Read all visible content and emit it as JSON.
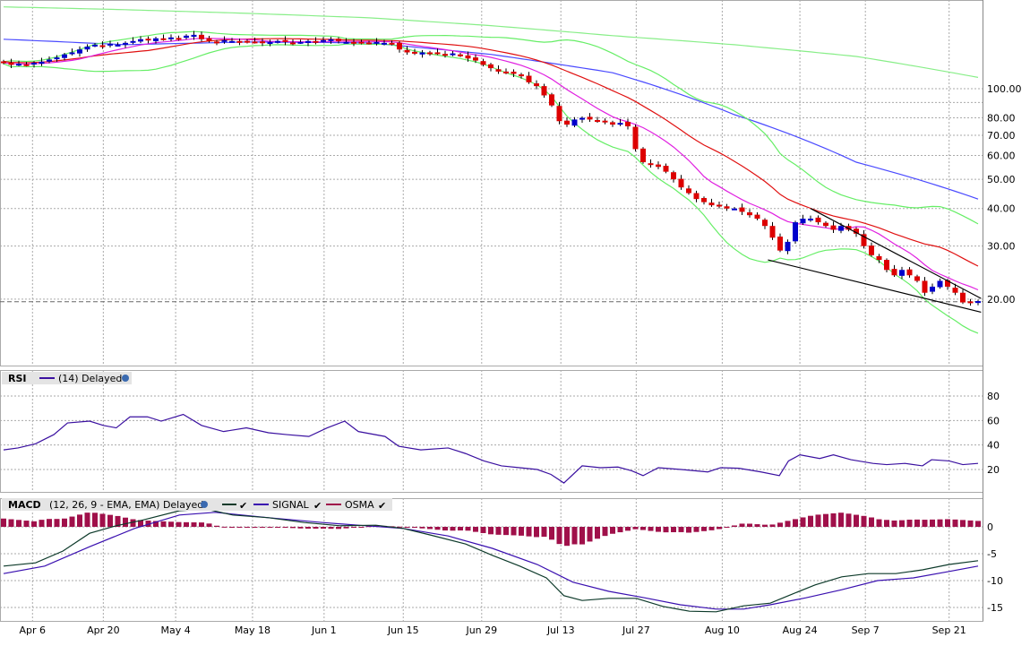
{
  "chart_data": {
    "type": "candlestick",
    "price_scale": "log",
    "price_ticks": [
      "100.00",
      "80.00",
      "70.00",
      "60.00",
      "50.00",
      "40.00",
      "30.00",
      "20.00"
    ],
    "price_tick_values": [
      100,
      80,
      70,
      60,
      50,
      40,
      30,
      20
    ],
    "last_price_line": 19.6,
    "closes": [
      122,
      120,
      121,
      120,
      122,
      123,
      125,
      127,
      130,
      132,
      135,
      138,
      140,
      139,
      141,
      140,
      142,
      144,
      146,
      145,
      147,
      146,
      148,
      147,
      150,
      151,
      146,
      144,
      143,
      145,
      144,
      143,
      144,
      143,
      142,
      143,
      144,
      143,
      142,
      143,
      144,
      143,
      145,
      146,
      144,
      143,
      142,
      143,
      142,
      143,
      142,
      141,
      135,
      132,
      131,
      132,
      131,
      131,
      130,
      131,
      129,
      126,
      124,
      120,
      117,
      114,
      113,
      112,
      110,
      105,
      102,
      95,
      88,
      78,
      76,
      79,
      80,
      79,
      78,
      78,
      76,
      77,
      75,
      63,
      57,
      56,
      55,
      53,
      50,
      47,
      45,
      43,
      42,
      41,
      41,
      40,
      40,
      39,
      38,
      37,
      35,
      32,
      29,
      31,
      36,
      37,
      37,
      36,
      35,
      34,
      35,
      34,
      33,
      30,
      28,
      27,
      25,
      24,
      25,
      24,
      23,
      21,
      22,
      23,
      22,
      21,
      19.5,
      19.5,
      19.7
    ],
    "ma50_samples": {
      "index": [
        0,
        16,
        32,
        48,
        64,
        80,
        96,
        112,
        128
      ],
      "values": [
        146,
        140,
        143,
        142,
        130,
        113,
        82,
        57,
        43
      ]
    },
    "ma200_samples": {
      "index": [
        0,
        16,
        32,
        48,
        64,
        80,
        96,
        112,
        128
      ],
      "values": [
        187,
        183,
        178,
        172,
        162,
        150,
        140,
        128,
        109
      ]
    },
    "trendlines": [
      {
        "from": [
          106,
          40
        ],
        "to": [
          128.4,
          20.1
        ]
      },
      {
        "from": [
          100.4,
          27
        ],
        "to": [
          128.4,
          18.1
        ]
      }
    ],
    "x_ticks": [
      {
        "label": "Apr 6",
        "index": 3.8
      },
      {
        "label": "Apr 20",
        "index": 13.1
      },
      {
        "label": "May 4",
        "index": 22.6
      },
      {
        "label": "May 18",
        "index": 32.7
      },
      {
        "label": "Jun 1",
        "index": 42.1
      },
      {
        "label": "Jun 15",
        "index": 52.5
      },
      {
        "label": "Jun 29",
        "index": 62.8
      },
      {
        "label": "Jul 13",
        "index": 73.2
      },
      {
        "label": "Jul 27",
        "index": 83.1
      },
      {
        "label": "Aug 10",
        "index": 94.4
      },
      {
        "label": "Aug 24",
        "index": 104.6
      },
      {
        "label": "Sep 7",
        "index": 113.2
      },
      {
        "label": "Sep 21",
        "index": 124.2
      }
    ],
    "rsi": {
      "label": "RSI",
      "params": "(14) Delayed",
      "ticks": [
        "80",
        "60",
        "40",
        "20"
      ],
      "tick_values": [
        80,
        60,
        40,
        20
      ],
      "points": [
        [
          0,
          36
        ],
        [
          1.9,
          37.6
        ],
        [
          4.2,
          41
        ],
        [
          6.6,
          48.5
        ],
        [
          8.4,
          58
        ],
        [
          11.3,
          59.5
        ],
        [
          13.1,
          56
        ],
        [
          14.8,
          54
        ],
        [
          16.6,
          63
        ],
        [
          18.9,
          63
        ],
        [
          20.7,
          59.5
        ],
        [
          23.6,
          65
        ],
        [
          26,
          56
        ],
        [
          28.9,
          51
        ],
        [
          31.9,
          54
        ],
        [
          34.8,
          50
        ],
        [
          37.2,
          48.5
        ],
        [
          40.1,
          47
        ],
        [
          42.5,
          54
        ],
        [
          44.8,
          59.5
        ],
        [
          46.6,
          51
        ],
        [
          50.1,
          47
        ],
        [
          51.9,
          39
        ],
        [
          54.8,
          36
        ],
        [
          58.4,
          37.6
        ],
        [
          60.7,
          33
        ],
        [
          63.1,
          27
        ],
        [
          65.4,
          23
        ],
        [
          67.8,
          21.5
        ],
        [
          70.1,
          20
        ],
        [
          71.9,
          16
        ],
        [
          73.6,
          9
        ],
        [
          76,
          23
        ],
        [
          78.4,
          21.5
        ],
        [
          80.7,
          22
        ],
        [
          82.5,
          19
        ],
        [
          84,
          15
        ],
        [
          86,
          21.5
        ],
        [
          89,
          20
        ],
        [
          92.5,
          18
        ],
        [
          94.2,
          21.5
        ],
        [
          96.6,
          21
        ],
        [
          99.5,
          18
        ],
        [
          101.9,
          15
        ],
        [
          103.1,
          27
        ],
        [
          104.6,
          32
        ],
        [
          107.2,
          29
        ],
        [
          109,
          32
        ],
        [
          111.3,
          28
        ],
        [
          114.2,
          25
        ],
        [
          116,
          24
        ],
        [
          118.4,
          25
        ],
        [
          120.7,
          23
        ],
        [
          121.9,
          28
        ],
        [
          124.2,
          27
        ],
        [
          126,
          24
        ],
        [
          128,
          25
        ]
      ]
    },
    "macd": {
      "label": "MACD",
      "params": "(12, 26, 9 - EMA, EMA) Delayed",
      "legend": [
        "",
        "SIGNAL",
        "OSMA"
      ],
      "ticks": [
        "0",
        "-5",
        "-10",
        "-15"
      ],
      "tick_values": [
        0,
        -5,
        -10,
        -15
      ],
      "macd_points": [
        [
          0,
          -7.3
        ],
        [
          4.2,
          -6.7
        ],
        [
          7.8,
          -4.5
        ],
        [
          11.3,
          -1.2
        ],
        [
          14.8,
          0.2
        ],
        [
          18.4,
          1.3
        ],
        [
          23.1,
          3
        ],
        [
          26.6,
          3.3
        ],
        [
          30.1,
          2.2
        ],
        [
          34.8,
          1.7
        ],
        [
          39.5,
          0.8
        ],
        [
          44.2,
          0.2
        ],
        [
          48.9,
          0.3
        ],
        [
          52.5,
          -0.3
        ],
        [
          56,
          -1.5
        ],
        [
          60.7,
          -3.2
        ],
        [
          64.2,
          -5.3
        ],
        [
          67.8,
          -7.3
        ],
        [
          71.3,
          -9.5
        ],
        [
          73.6,
          -12.8
        ],
        [
          76,
          -13.7
        ],
        [
          79.5,
          -13.3
        ],
        [
          83.1,
          -13.3
        ],
        [
          86.6,
          -14.8
        ],
        [
          90.1,
          -15.7
        ],
        [
          93.6,
          -15.8
        ],
        [
          97.2,
          -14.7
        ],
        [
          100.7,
          -14.2
        ],
        [
          103.1,
          -12.8
        ],
        [
          106.6,
          -10.8
        ],
        [
          110.1,
          -9.3
        ],
        [
          113.6,
          -8.7
        ],
        [
          117.2,
          -8.7
        ],
        [
          120.7,
          -8
        ],
        [
          124.2,
          -7
        ],
        [
          128,
          -6.3
        ]
      ],
      "signal_points": [
        [
          0,
          -8.7
        ],
        [
          5.4,
          -7.3
        ],
        [
          11.3,
          -3.7
        ],
        [
          17.2,
          -0.3
        ],
        [
          23.1,
          2.2
        ],
        [
          27.8,
          2.7
        ],
        [
          34.8,
          1.7
        ],
        [
          41.9,
          0.8
        ],
        [
          46.6,
          0.3
        ],
        [
          52.5,
          -0.3
        ],
        [
          58.4,
          -1.7
        ],
        [
          64.2,
          -4
        ],
        [
          70.1,
          -7
        ],
        [
          74.8,
          -10.3
        ],
        [
          79.5,
          -12
        ],
        [
          84.2,
          -13.2
        ],
        [
          88.9,
          -14.5
        ],
        [
          93.6,
          -15.3
        ],
        [
          97.2,
          -15.3
        ],
        [
          100.7,
          -14.5
        ],
        [
          105.4,
          -13.2
        ],
        [
          110.1,
          -11.7
        ],
        [
          114.8,
          -10
        ],
        [
          119.5,
          -9.5
        ],
        [
          124.2,
          -8.3
        ],
        [
          128,
          -7.3
        ]
      ]
    },
    "colors": {
      "up": "#0000cc",
      "down": "#dd0000",
      "ma10": "#e020e0",
      "ma20": "#e01010",
      "ma50": "#4a4aff",
      "bollinger": "#66ee66",
      "ma200": "#88ee88",
      "rsi": "#3a10a0",
      "macd": "#0d3a2a",
      "signal": "#3a10b0",
      "osma": "#a0104a"
    }
  }
}
